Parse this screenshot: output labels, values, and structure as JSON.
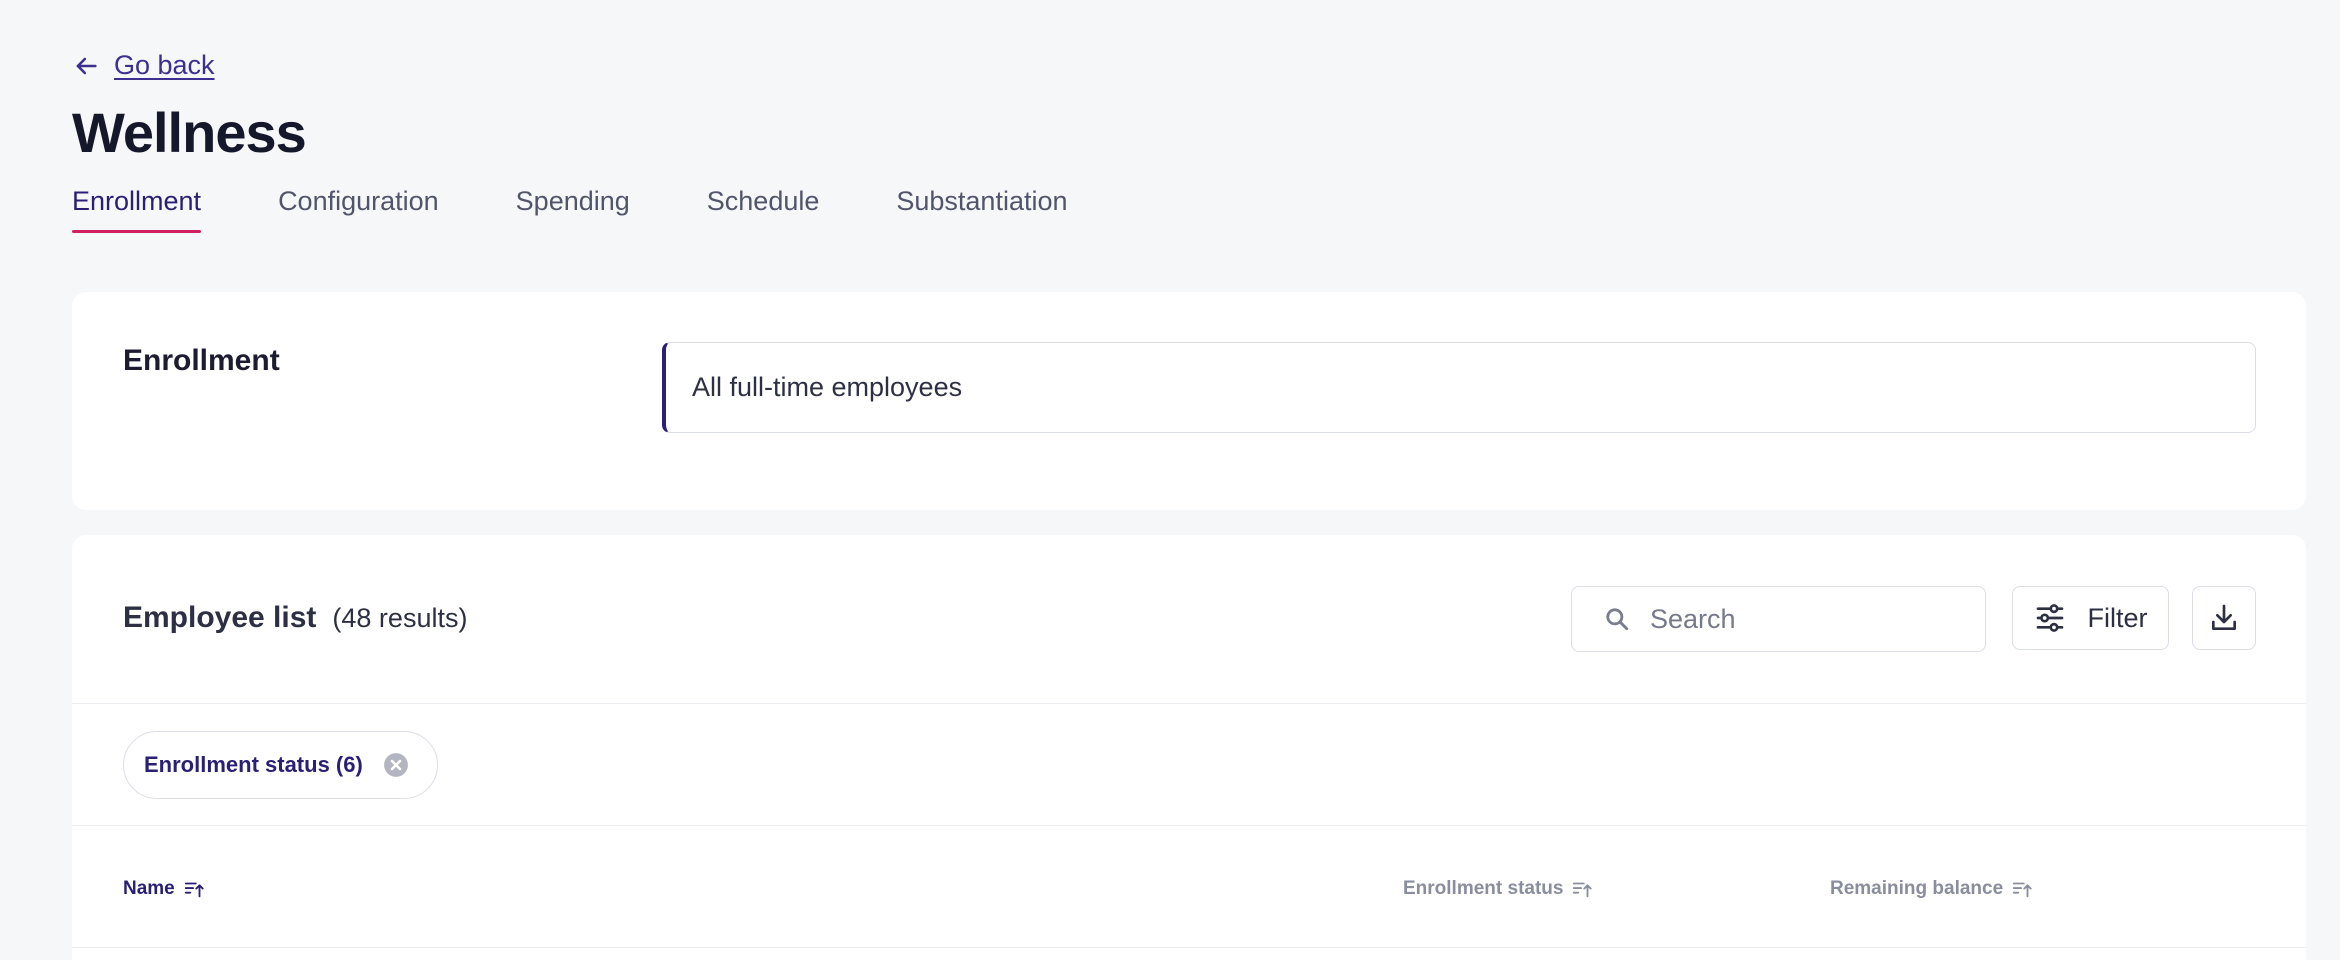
{
  "nav": {
    "back_label": "Go back"
  },
  "page": {
    "title": "Wellness"
  },
  "tabs": [
    {
      "label": "Enrollment",
      "active": true
    },
    {
      "label": "Configuration",
      "active": false
    },
    {
      "label": "Spending",
      "active": false
    },
    {
      "label": "Schedule",
      "active": false
    },
    {
      "label": "Substantiation",
      "active": false
    }
  ],
  "enrollment": {
    "label": "Enrollment",
    "value": "All full-time employees"
  },
  "employee_list": {
    "title": "Employee list",
    "count": "(48 results)",
    "search_placeholder": "Search",
    "filter_label": "Filter",
    "active_filter_chip": "Enrollment status (6)",
    "columns": [
      "Name",
      "Enrollment status",
      "Remaining balance"
    ]
  },
  "theme": {
    "primary": "#2a1f74",
    "tab_underline": "#d1205f",
    "background": "#f6f7f9"
  }
}
